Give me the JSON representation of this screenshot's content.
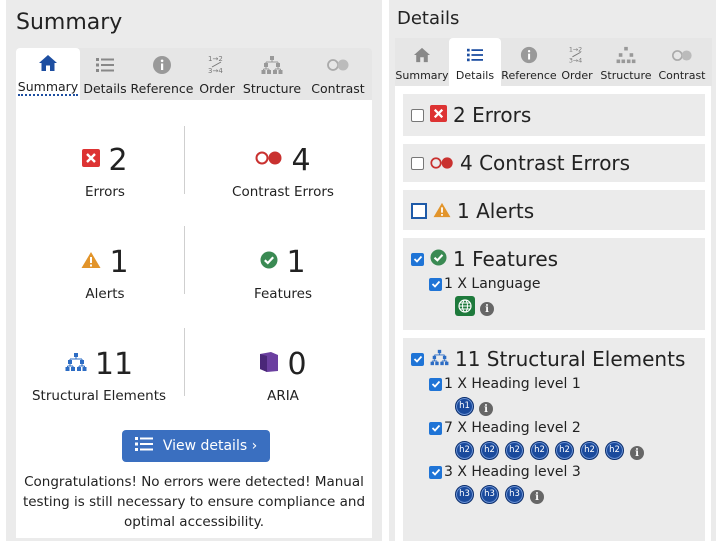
{
  "colors": {
    "error": "#d33",
    "contrast": "#c9312f",
    "alert": "#e2942a",
    "feature": "#3a8a53",
    "structure": "#2c6cc4",
    "aria": "#6b3fa0",
    "accent": "#3a6fc0",
    "badge": "#1a4a9c"
  },
  "tab_labels": [
    "Summary",
    "Details",
    "Reference",
    "Order",
    "Structure",
    "Contrast"
  ],
  "tab_icons": [
    "home-icon",
    "list-icon",
    "info-icon",
    "order-icon",
    "structure-icon",
    "contrast-icon"
  ],
  "summary": {
    "title": "Summary",
    "active_tab": "Summary",
    "stats": [
      {
        "icon": "error-icon",
        "count": "2",
        "label": "Errors"
      },
      {
        "icon": "contrast-icon",
        "count": "4",
        "label": "Contrast Errors"
      },
      {
        "icon": "alert-icon",
        "count": "1",
        "label": "Alerts"
      },
      {
        "icon": "feature-icon",
        "count": "1",
        "label": "Features"
      },
      {
        "icon": "structure-icon",
        "count": "11",
        "label": "Structural Elements"
      },
      {
        "icon": "aria-icon",
        "count": "0",
        "label": "ARIA"
      }
    ],
    "view_details": "View details ›",
    "message": "Congratulations! No errors were detected! Manual testing is still necessary to ensure compliance and optimal accessibility."
  },
  "details": {
    "title": "Details",
    "active_tab": "Details",
    "errors": "2 Errors",
    "contrast_errors": "4 Contrast Errors",
    "alerts": "1 Alerts",
    "features": "1 Features",
    "language": "1 X Language",
    "structural": "11 Structural Elements",
    "h1_label": "1 X Heading level 1",
    "h2_label": "7 X Heading level 2",
    "h3_label": "3 X Heading level 3",
    "h1": "h1",
    "h2": "h2",
    "h3": "h3"
  }
}
